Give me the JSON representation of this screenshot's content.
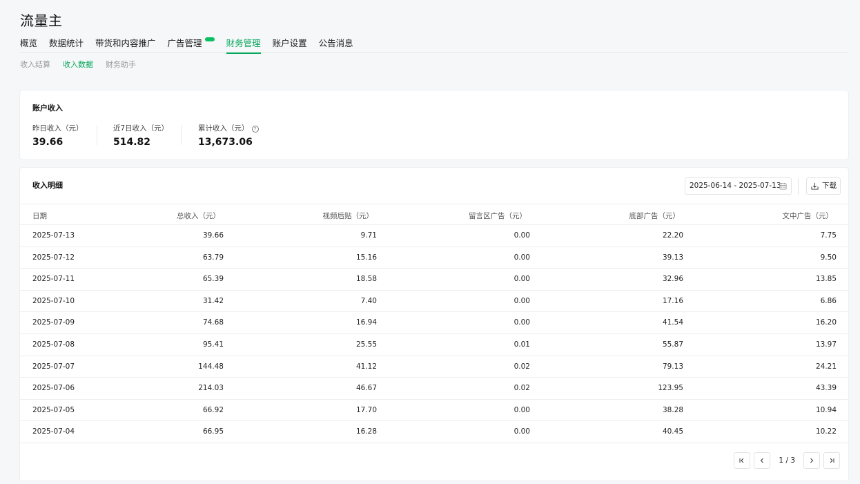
{
  "app": {
    "title": "流量主"
  },
  "main_tabs": [
    {
      "label": "概览",
      "active": false
    },
    {
      "label": "数据统计",
      "active": false
    },
    {
      "label": "带货和内容推广",
      "active": false
    },
    {
      "label": "广告管理",
      "active": false,
      "badge": true
    },
    {
      "label": "财务管理",
      "active": true
    },
    {
      "label": "账户设置",
      "active": false
    },
    {
      "label": "公告消息",
      "active": false
    }
  ],
  "sub_tabs": [
    {
      "label": "收入结算",
      "active": false
    },
    {
      "label": "收入数据",
      "active": true
    },
    {
      "label": "财务助手",
      "active": false
    }
  ],
  "summary": {
    "title": "账户收入",
    "stats": [
      {
        "label": "昨日收入（元）",
        "value": "39.66"
      },
      {
        "label": "近7日收入（元）",
        "value": "514.82"
      },
      {
        "label": "累计收入（元）",
        "value": "13,673.06",
        "help": true
      }
    ]
  },
  "detail": {
    "title": "收入明细",
    "date_range": "2025-06-14 - 2025-07-13",
    "download_label": "下载",
    "columns": [
      "日期",
      "总收入（元）",
      "视频后贴（元）",
      "留言区广告（元）",
      "底部广告（元）",
      "文中广告（元）"
    ],
    "rows": [
      [
        "2025-07-13",
        "39.66",
        "9.71",
        "0.00",
        "22.20",
        "7.75"
      ],
      [
        "2025-07-12",
        "63.79",
        "15.16",
        "0.00",
        "39.13",
        "9.50"
      ],
      [
        "2025-07-11",
        "65.39",
        "18.58",
        "0.00",
        "32.96",
        "13.85"
      ],
      [
        "2025-07-10",
        "31.42",
        "7.40",
        "0.00",
        "17.16",
        "6.86"
      ],
      [
        "2025-07-09",
        "74.68",
        "16.94",
        "0.00",
        "41.54",
        "16.20"
      ],
      [
        "2025-07-08",
        "95.41",
        "25.55",
        "0.01",
        "55.87",
        "13.97"
      ],
      [
        "2025-07-07",
        "144.48",
        "41.12",
        "0.02",
        "79.13",
        "24.21"
      ],
      [
        "2025-07-06",
        "214.03",
        "46.67",
        "0.02",
        "123.95",
        "43.39"
      ],
      [
        "2025-07-05",
        "66.92",
        "17.70",
        "0.00",
        "38.28",
        "10.94"
      ],
      [
        "2025-07-04",
        "66.95",
        "16.28",
        "0.00",
        "40.45",
        "10.22"
      ]
    ],
    "pagination": {
      "text": "1 / 3"
    }
  },
  "colors": {
    "accent": "#07a85c",
    "badge": "#07c160"
  },
  "icons": {
    "calendar": "calendar-icon",
    "download": "download-icon",
    "help": "help-circle-icon",
    "first": "first-page-icon",
    "prev": "chevron-left-icon",
    "next": "chevron-right-icon",
    "last": "last-page-icon"
  }
}
